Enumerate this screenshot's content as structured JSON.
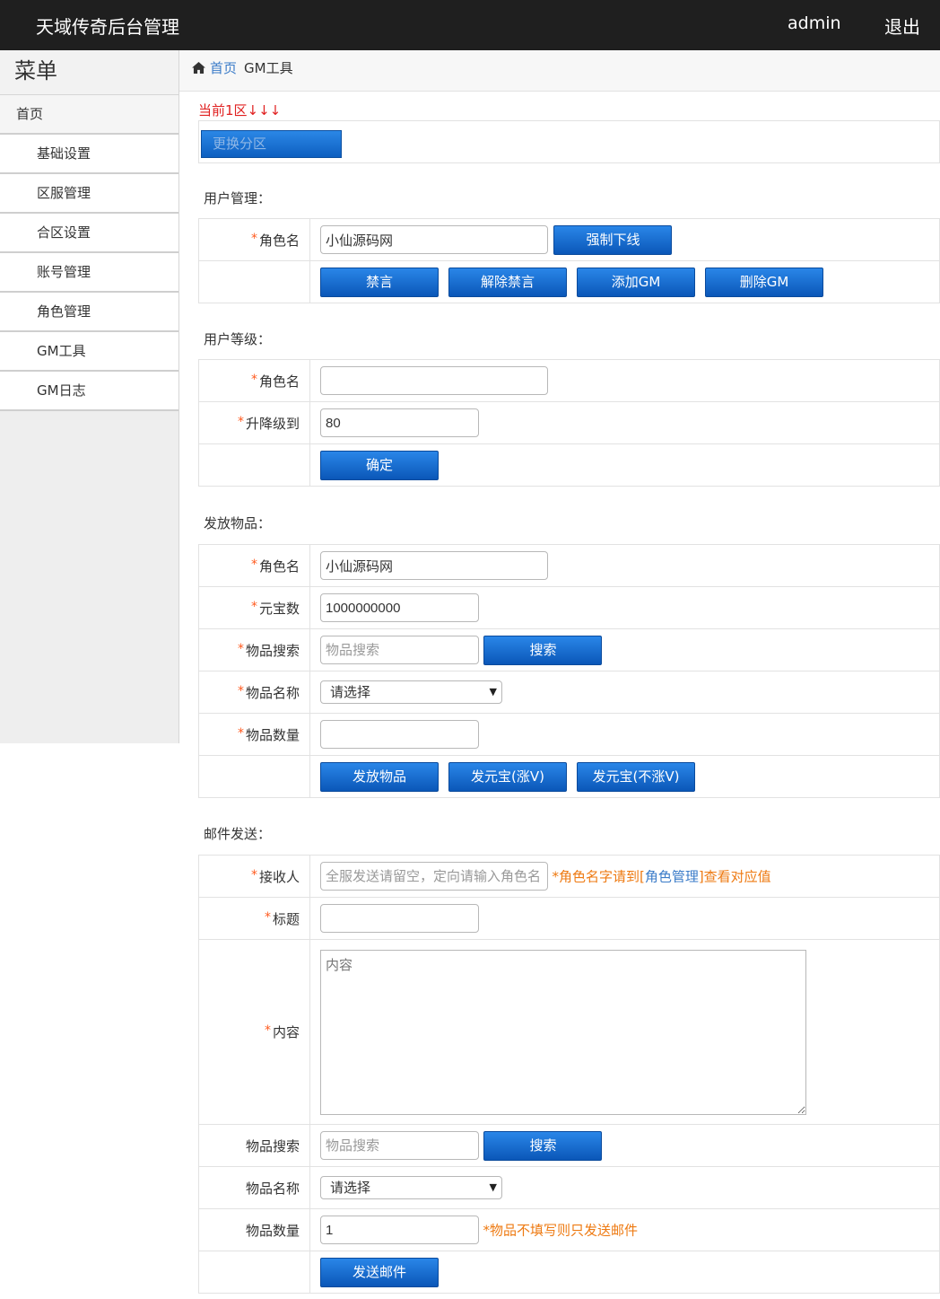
{
  "header": {
    "title": "天域传奇后台管理",
    "user": "admin",
    "logout": "退出"
  },
  "sidebar": {
    "title": "菜单",
    "home": "首页",
    "items": [
      "基础设置",
      "区服管理",
      "合区设置",
      "账号管理",
      "角色管理",
      "GM工具",
      "GM日志"
    ]
  },
  "breadcrumb": {
    "home": "首页",
    "current": "GM工具"
  },
  "zone": {
    "current": "当前1区↓↓↓",
    "change_button": "更换分区"
  },
  "user_manage": {
    "title": "用户管理：",
    "role_label": "角色名",
    "role_value": "小仙源码网",
    "kick_button": "强制下线",
    "mute_button": "禁言",
    "unmute_button": "解除禁言",
    "add_gm_button": "添加GM",
    "del_gm_button": "删除GM"
  },
  "user_level": {
    "title": "用户等级：",
    "role_label": "角色名",
    "role_value": "",
    "level_label": "升降级到",
    "level_value": "80",
    "confirm_button": "确定"
  },
  "give_item": {
    "title": "发放物品：",
    "role_label": "角色名",
    "role_value": "小仙源码网",
    "yuanbao_label": "元宝数",
    "yuanbao_value": "1000000000",
    "search_label": "物品搜索",
    "search_placeholder": "物品搜索",
    "search_button": "搜索",
    "name_label": "物品名称",
    "name_select": "请选择",
    "qty_label": "物品数量",
    "qty_value": "",
    "give_button": "发放物品",
    "yb_v_button": "发元宝(涨V)",
    "yb_nov_button": "发元宝(不涨V)"
  },
  "mail": {
    "title": "邮件发送：",
    "receiver_label": "接收人",
    "receiver_placeholder": "全服发送请留空，定向请输入角色名",
    "receiver_hint_pre": "*角色名字请到[",
    "receiver_hint_link": "角色管理",
    "receiver_hint_post": "]查看对应值",
    "subject_label": "标题",
    "subject_value": "",
    "content_label": "内容",
    "content_placeholder": "内容",
    "search_label": "物品搜索",
    "search_placeholder": "物品搜索",
    "search_button": "搜索",
    "name_label": "物品名称",
    "name_select": "请选择",
    "qty_label": "物品数量",
    "qty_value": "1",
    "qty_hint": "*物品不填写则只发送邮件",
    "send_button": "发送邮件"
  },
  "colors": {
    "topbar": "#1f1f1f",
    "button": "#0d6dd6",
    "required": "#ff5a1f",
    "hint": "#ee7a12",
    "link": "#3a7bc8",
    "zone_text": "#e02020"
  },
  "icons": {
    "home": "home-icon",
    "select_arrow": "caret-down-icon"
  }
}
